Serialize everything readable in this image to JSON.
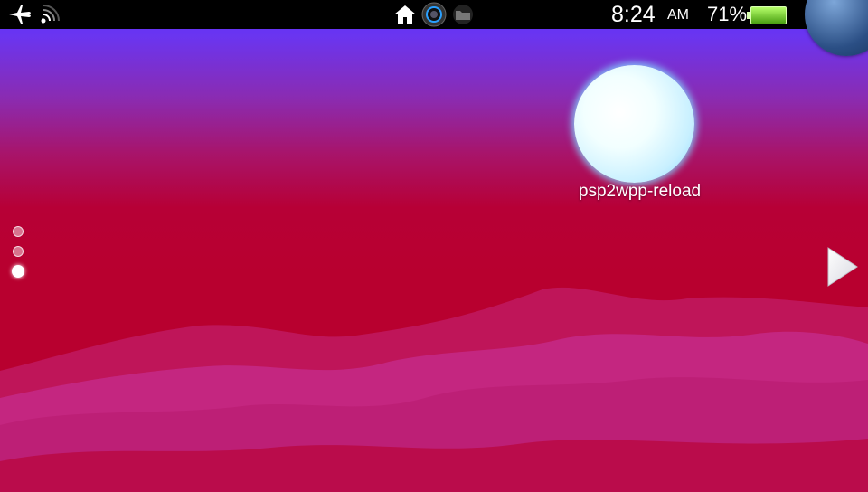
{
  "status_bar": {
    "left_icons": [
      "airplane-icon",
      "wifi-icon"
    ],
    "center_icons": [
      "home-icon",
      "camera-icon",
      "folder-icon"
    ],
    "time": "8:24",
    "ampm": "AM",
    "battery_percent": "71%",
    "battery_level": 0.71
  },
  "home": {
    "apps": [
      {
        "label": "psp2wpp-reload",
        "icon": "bubble-icon"
      }
    ],
    "pages": {
      "count": 3,
      "current": 3
    }
  },
  "colors": {
    "sky_top": "#5a2cff",
    "background": "#b8002f",
    "bubble_glow": "#83d4ff",
    "battery": "#6ac41e"
  }
}
